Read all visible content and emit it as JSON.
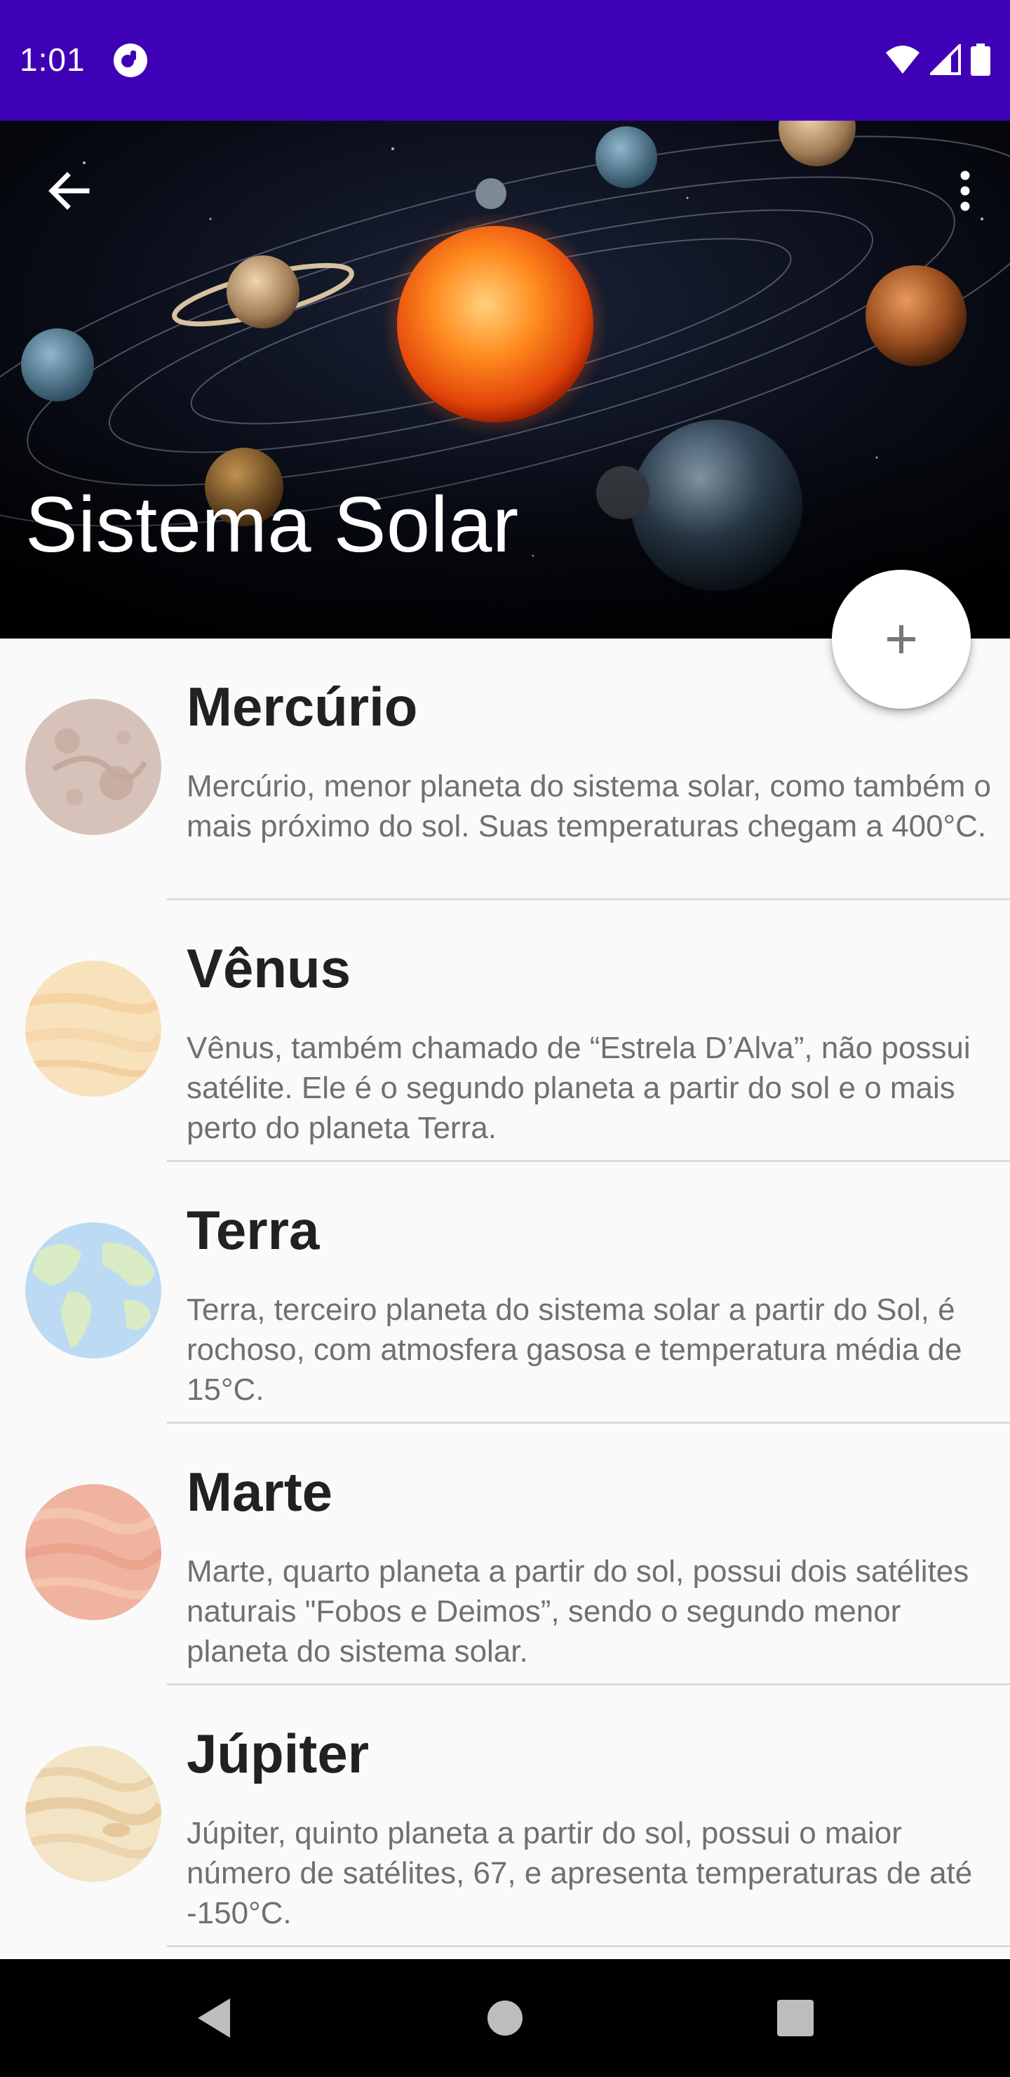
{
  "status_bar": {
    "time": "1:01",
    "app_icon": "app-notification-icon",
    "icons": [
      "wifi-icon",
      "signal-icon",
      "battery-icon"
    ],
    "background_color": "#3f01b6"
  },
  "header": {
    "title": "Sistema Solar",
    "back_icon": "arrow-back-icon",
    "menu_icon": "more-vert-icon",
    "image": "solar-system-illustration"
  },
  "fab": {
    "icon": "add-icon",
    "label": "+"
  },
  "planets": [
    {
      "name": "Mercúrio",
      "description": "Mercúrio, menor planeta do sistema solar, como também o mais próximo do sol. Suas temperaturas chegam a 400°C.",
      "color": "#d6c2b8"
    },
    {
      "name": "Vênus",
      "description": "Vênus, também chamado de “Estrela D’Alva”, não possui satélite. Ele é o segundo planeta a partir do sol e o mais perto do planeta Terra.",
      "color": "#f7dfb6"
    },
    {
      "name": "Terra",
      "description": "Terra, terceiro planeta do sistema solar a partir do Sol, é rochoso, com atmosfera gasosa e temperatura média de 15°C.",
      "color": "#bfdcf2"
    },
    {
      "name": "Marte",
      "description": "Marte, quarto planeta a partir do sol, possui dois satélites naturais \"Fobos e Deimos”, sendo o segundo menor planeta do sistema solar.",
      "color": "#f0b5a0"
    },
    {
      "name": "Júpiter",
      "description": "Júpiter, quinto planeta a partir do sol, possui o maior número de satélites, 67, e apresenta temperaturas de até -150°C.",
      "color": "#f3e2c4"
    }
  ],
  "nav_bar": {
    "buttons": [
      "back-triangle-icon",
      "home-circle-icon",
      "recents-square-icon"
    ]
  }
}
